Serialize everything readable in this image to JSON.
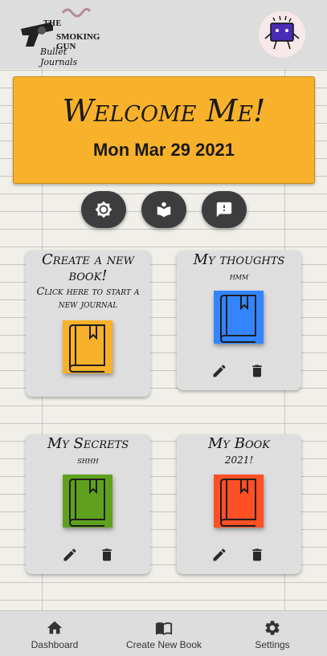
{
  "header": {
    "logo": {
      "line1": "THE",
      "line2": "SMOKING GUN",
      "line3": "Bullet Journals",
      "icon": "revolver-logo"
    },
    "avatar_icon": "purple-monster-avatar"
  },
  "banner": {
    "welcome": "Welcome Me!",
    "date": "Mon Mar 29 2021",
    "color": "#f8b12a"
  },
  "action_buttons": [
    {
      "icon": "brightness-icon"
    },
    {
      "icon": "reading-book-icon"
    },
    {
      "icon": "feedback-icon"
    }
  ],
  "cards": {
    "create": {
      "title": "Create a new book!",
      "subtitle": "Click here to start a new journal",
      "book_color": "#f8b12a"
    },
    "books": [
      {
        "title": "My thoughts",
        "subtitle": "hmm",
        "color": "#3385ff"
      },
      {
        "title": "My Secrets",
        "subtitle": "shhh",
        "color": "#5fa11f"
      },
      {
        "title": "My Book",
        "subtitle": "2021!",
        "color": "#ff4f24"
      }
    ],
    "edit_icon": "pencil-icon",
    "delete_icon": "trash-icon"
  },
  "bottom_nav": [
    {
      "label": "Dashboard",
      "icon": "home-icon"
    },
    {
      "label": "Create New Book",
      "icon": "open-book-icon"
    },
    {
      "label": "Settings",
      "icon": "gear-icon"
    }
  ]
}
